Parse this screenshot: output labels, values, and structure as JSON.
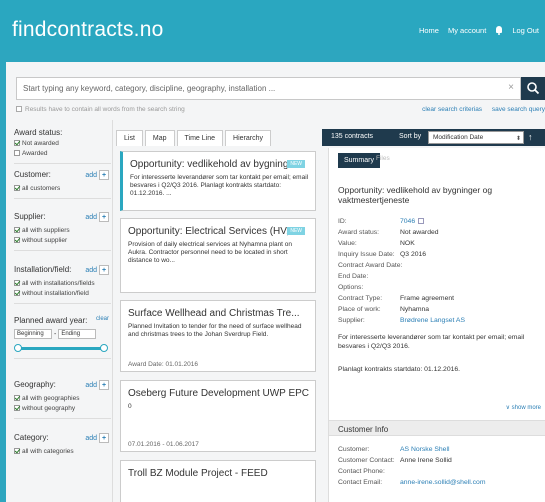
{
  "header": {
    "logo": "findcontracts.no",
    "nav": {
      "home": "Home",
      "account": "My account",
      "logout": "Log Out"
    }
  },
  "search": {
    "placeholder": "Start typing any keyword, category, discipline, geography, installation ...",
    "clear": "×",
    "option_label": "Results have to contain all words from the search string",
    "clear_criterias": "clear search criterias",
    "save_query": "save search query"
  },
  "sidebar": {
    "award_status": {
      "title": "Award status:",
      "options": [
        "Not awarded",
        "Awarded"
      ]
    },
    "customer": {
      "title": "Customer:",
      "add": "add",
      "options": [
        "all customers"
      ]
    },
    "supplier": {
      "title": "Supplier:",
      "add": "add",
      "options": [
        "all with suppliers",
        "without supplier"
      ]
    },
    "installation": {
      "title": "Installation/field:",
      "add": "add",
      "options": [
        "all with installations/fields",
        "without installation/field"
      ]
    },
    "planned_year": {
      "title": "Planned award year:",
      "clear": "clear",
      "from": "Beginning",
      "sep": "-",
      "to": "Ending"
    },
    "geography": {
      "title": "Geography:",
      "add": "add",
      "options": [
        "all with geographies",
        "without geography"
      ]
    },
    "category": {
      "title": "Category:",
      "add": "add",
      "options": [
        "all with categories"
      ]
    }
  },
  "tabs": [
    "List",
    "Map",
    "Time Line",
    "Hierarchy"
  ],
  "results": {
    "count": "135 contracts",
    "sort_label": "Sort by",
    "sort_value": "Modification Date",
    "sort_dir": "↑"
  },
  "cards": [
    {
      "title": "Opportunity: vedlikehold av bygning...",
      "badge": "NEW",
      "desc": "For interesserte leverandører som tar kontakt per email; email besvares i Q2/Q3 2016. Planlagt kontrakts startdato: 01.12.2016. ...",
      "date": ""
    },
    {
      "title": "Opportunity: Electrical Services (HV,...",
      "badge": "NEW",
      "desc": "Provision of daily electrical services at Nyhamna plant on Aukra. Contractor personnel need to be located in short distance to wo...",
      "date": ""
    },
    {
      "title": "Surface Wellhead and Christmas Tre...",
      "badge": "",
      "desc": "Planned Invitation to tender for the need of surface wellhead and christmas trees to the Johan Sverdrup Field.",
      "date": "Award Date: 01.01.2016"
    },
    {
      "title": "Oseberg Future Development UWP EPC",
      "badge": "",
      "desc": "0",
      "date": "07.01.2016 - 01.06.2017"
    },
    {
      "title": "Troll BZ Module Project - FEED",
      "badge": "",
      "desc": "",
      "date": ""
    }
  ],
  "detail": {
    "tab_summary": "Summary",
    "tab_other": "Files",
    "title": "Opportunity: vedlikehold av bygninger og vaktmestertjeneste",
    "fields": [
      {
        "k": "ID:",
        "v": "7046"
      },
      {
        "k": "Award status:",
        "v": "Not awarded"
      },
      {
        "k": "Value:",
        "v": "NOK"
      },
      {
        "k": "Inquiry Issue Date:",
        "v": "Q3 2016"
      },
      {
        "k": "Contract Award Date:",
        "v": ""
      },
      {
        "k": "End Date:",
        "v": ""
      },
      {
        "k": "Options:",
        "v": ""
      },
      {
        "k": "Contract Type:",
        "v": "Frame agreement"
      },
      {
        "k": "Place of work:",
        "v": "Nyhamna"
      },
      {
        "k": "Supplier:",
        "v": "Brødrene Langset AS"
      }
    ],
    "note1": "For interesserte leverandører som tar kontakt per email; email besvares i Q2/Q3 2016.",
    "note2": "Planlagt kontrakts startdato: 01.12.2016.",
    "show_more": "show more",
    "customer_info": "Customer Info",
    "customer_fields": [
      {
        "k": "Customer:",
        "v": "AS Norske Shell"
      },
      {
        "k": "Customer Contact:",
        "v": "Anne Irene Sollid"
      },
      {
        "k": "Contact Phone:",
        "v": ""
      },
      {
        "k": "Contact Email:",
        "v": "anne-irene.sollid@shell.com"
      }
    ]
  }
}
